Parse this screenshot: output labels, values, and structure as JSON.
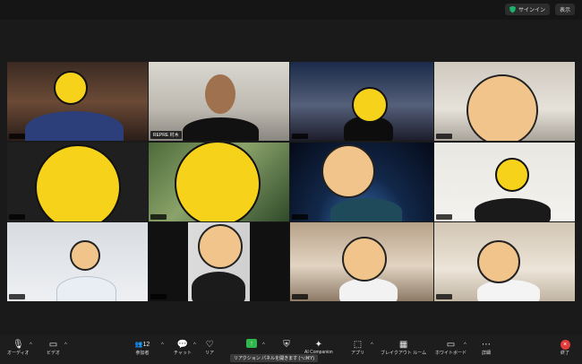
{
  "topbar": {
    "signin_label": "サインイン",
    "view_label": "表示"
  },
  "tiles": [
    {
      "id": "t1",
      "nameplate": ""
    },
    {
      "id": "t2",
      "nameplate": "REPRE 村木"
    },
    {
      "id": "t3",
      "nameplate": ""
    },
    {
      "id": "t4",
      "nameplate": ""
    },
    {
      "id": "t5",
      "nameplate": ""
    },
    {
      "id": "t6",
      "nameplate": ""
    },
    {
      "id": "t7",
      "nameplate": ""
    },
    {
      "id": "t8",
      "nameplate": ""
    },
    {
      "id": "t9",
      "nameplate": ""
    },
    {
      "id": "t10",
      "nameplate": ""
    },
    {
      "id": "t11",
      "nameplate": ""
    },
    {
      "id": "t12",
      "nameplate": ""
    }
  ],
  "toolbar": {
    "audio": "オーディオ",
    "video": "ビデオ",
    "participants": "参加者",
    "participants_count": "12",
    "chat": "チャット",
    "reactions": "リア",
    "ai_companion": "AI Companion",
    "apps": "アプリ",
    "breakout": "ブレイクアウト ルーム",
    "whiteboard": "ホワイトボード",
    "more": "詳細",
    "end": "終了",
    "tooltip": "リアクション パネルを開きます (⌥⌘Y)"
  },
  "colors": {
    "speaker_border": "#6bd43f",
    "end": "#e23b3b",
    "shield": "#19b36b",
    "smiley": "#f7d21a"
  }
}
